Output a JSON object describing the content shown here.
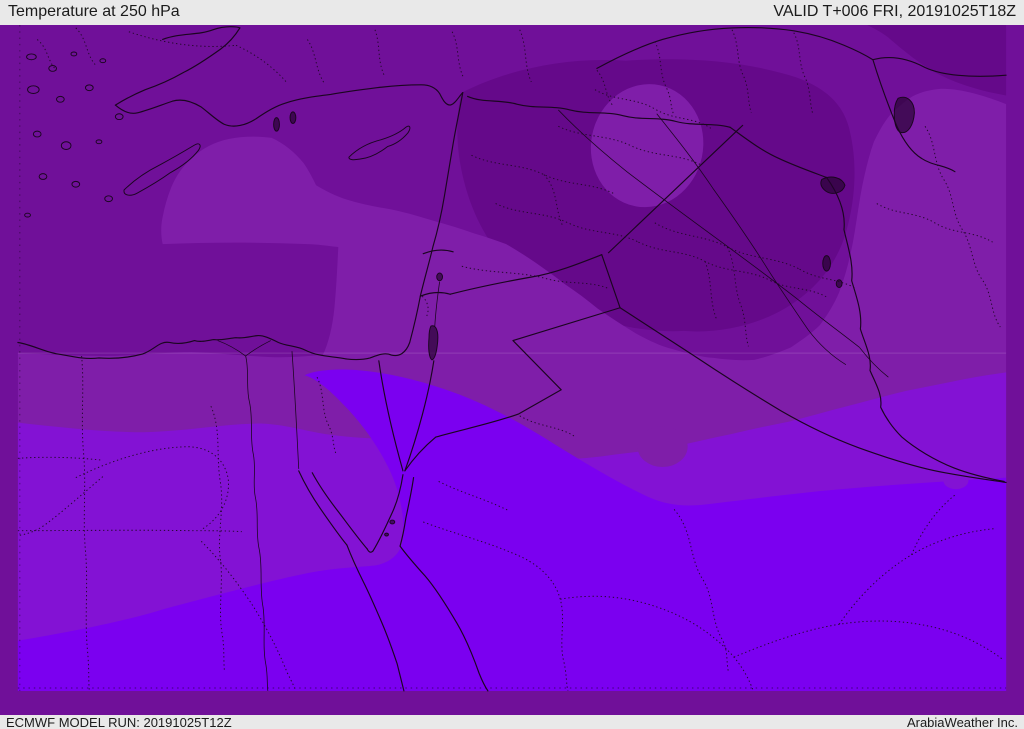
{
  "header": {
    "title": "Temperature at 250 hPa",
    "valid_label": "VALID T+006 FRI, 20191025T18Z"
  },
  "footer": {
    "model_run": "ECMWF MODEL RUN: 20191025T12Z",
    "attribution": "ArabiaWeather Inc."
  },
  "map": {
    "parameter": "Temperature",
    "level": "250 hPa",
    "model": "ECMWF",
    "temperature_shades": [
      {
        "name": "coldest",
        "hex": "#65098a"
      },
      {
        "name": "very-cold",
        "hex": "#701099"
      },
      {
        "name": "cold",
        "hex": "#7f1ea9"
      },
      {
        "name": "mild",
        "hex": "#8312d4"
      },
      {
        "name": "warmest",
        "hex": "#7b00f0"
      }
    ],
    "bar_background_hex": "#e9e9e9",
    "line_hex": "#1b0520"
  }
}
